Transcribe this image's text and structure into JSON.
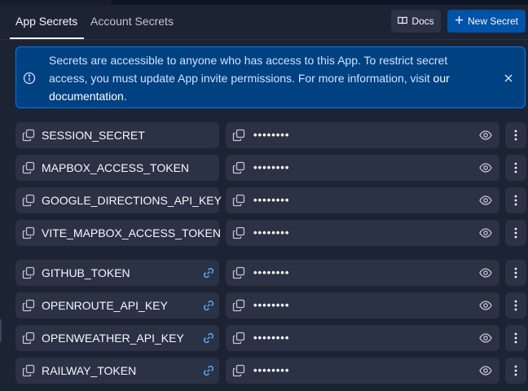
{
  "tabs": [
    {
      "label": "App Secrets",
      "active": true
    },
    {
      "label": "Account Secrets",
      "active": false
    }
  ],
  "actions": {
    "docs_label": "Docs",
    "new_secret_label": "New Secret"
  },
  "banner": {
    "text": "Secrets are accessible to anyone who has access to this App. To restrict secret access, you must update App invite permissions. For more information, visit",
    "link_text": "our documentation",
    "suffix": ".",
    "icons": {
      "info": "info-icon",
      "close": "close-icon"
    }
  },
  "secrets": [
    {
      "key": "SESSION_SECRET",
      "value_mask": "••••••••",
      "linked": false
    },
    {
      "key": "MAPBOX_ACCESS_TOKEN",
      "value_mask": "••••••••",
      "linked": false
    },
    {
      "key": "GOOGLE_DIRECTIONS_API_KEY",
      "value_mask": "••••••••",
      "linked": false
    },
    {
      "key": "VITE_MAPBOX_ACCESS_TOKEN",
      "value_mask": "••••••••",
      "linked": false
    },
    {
      "key": "GITHUB_TOKEN",
      "value_mask": "••••••••",
      "linked": true
    },
    {
      "key": "OPENROUTE_API_KEY",
      "value_mask": "••••••••",
      "linked": true
    },
    {
      "key": "OPENWEATHER_API_KEY",
      "value_mask": "••••••••",
      "linked": true
    },
    {
      "key": "RAILWAY_TOKEN",
      "value_mask": "••••••••",
      "linked": true
    }
  ],
  "colors": {
    "background": "#1c2333",
    "cell": "#2b3245",
    "primary": "#0053a6",
    "banner_bg": "#004182",
    "link_icon": "#5fa8ff"
  }
}
